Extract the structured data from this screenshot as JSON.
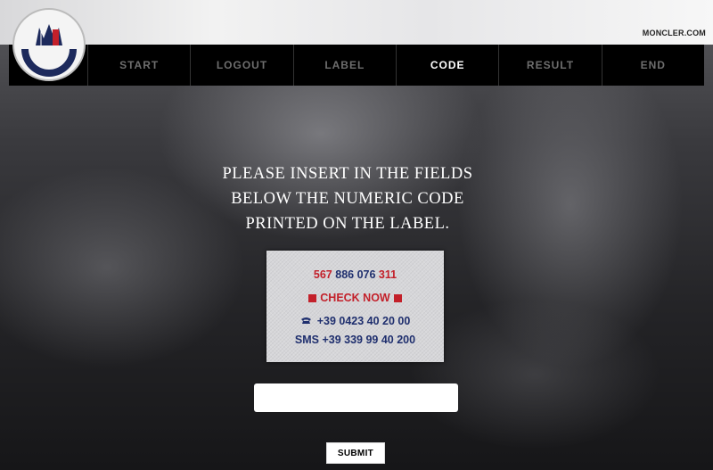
{
  "header": {
    "site_link": "MONCLER.COM",
    "logo_text": "MONCLER"
  },
  "nav": {
    "items": [
      {
        "label": "START"
      },
      {
        "label": "LOGOUT"
      },
      {
        "label": "LABEL"
      },
      {
        "label": "CODE"
      },
      {
        "label": "RESULT"
      },
      {
        "label": "END"
      }
    ],
    "active": "CODE"
  },
  "main": {
    "instruction_lines": [
      "PLEASE INSERT IN THE FIELDS",
      "BELOW THE NUMERIC CODE",
      "PRINTED ON THE LABEL."
    ]
  },
  "label_card": {
    "code_part1": "567",
    "code_part2": "886 076",
    "code_part3": "311",
    "check_now": "CHECK NOW",
    "phone": "+39 0423 40 20 00",
    "sms": "SMS +39 339 99 40 200"
  },
  "form": {
    "code_value": "",
    "submit_label": "SUBMIT"
  },
  "colors": {
    "accent_red": "#c3202a",
    "label_blue": "#1f2f6e",
    "nav_bg": "#000000"
  }
}
